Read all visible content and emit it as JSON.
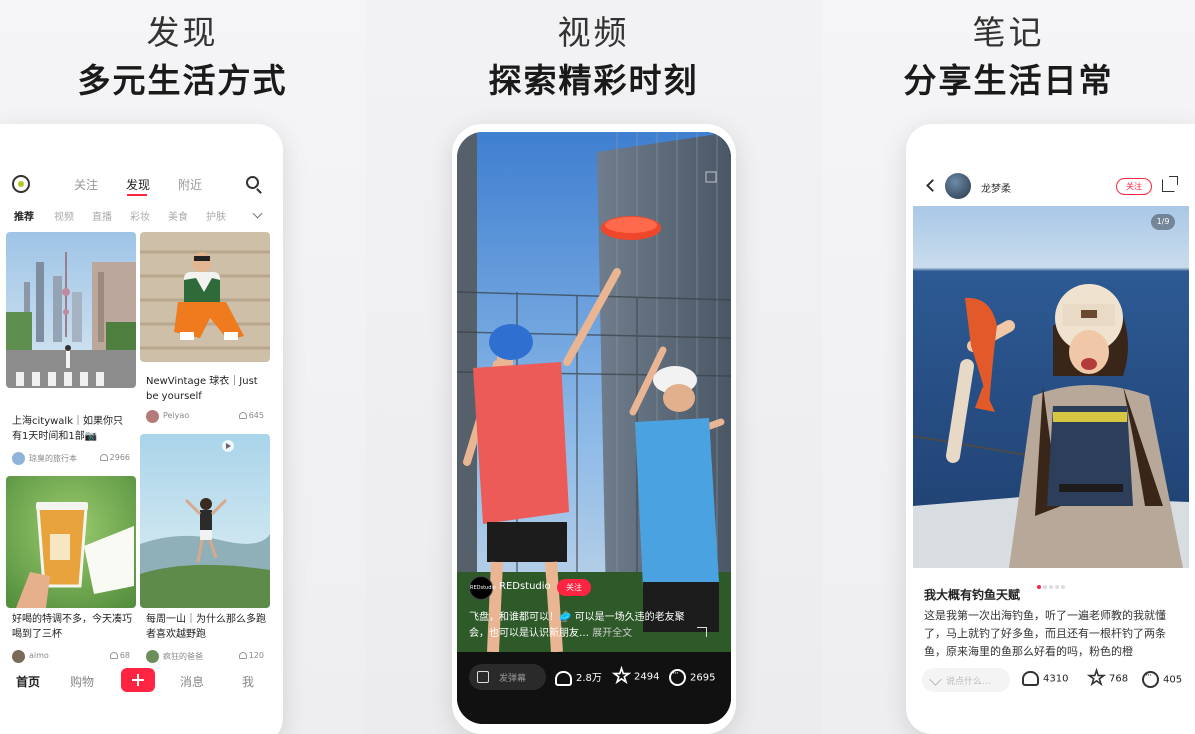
{
  "panels": [
    {
      "title": "发现",
      "subtitle": "多元生活方式"
    },
    {
      "title": "视频",
      "subtitle": "探索精彩时刻"
    },
    {
      "title": "笔记",
      "subtitle": "分享生活日常"
    }
  ],
  "discover": {
    "top_tabs": [
      "关注",
      "发现",
      "附近"
    ],
    "active_tab": "发现",
    "chips": [
      "推荐",
      "视频",
      "直播",
      "彩妆",
      "美食",
      "护肤"
    ],
    "cards": [
      {
        "title": "上海citywalk｜如果你只有1天时间和1部📷",
        "user": "琼臭的旅行本",
        "likes": "2966"
      },
      {
        "title": "NewVintage 球衣｜Just be yourself",
        "user": "Peiyao",
        "likes": "645"
      },
      {
        "title": "好喝的特调不多，今天凑巧喝到了三杯",
        "user": "aimo",
        "likes": "68"
      },
      {
        "title": "每周一山｜为什么那么多跑者喜欢越野跑",
        "user": "疯狂的爸爸",
        "likes": "120"
      }
    ],
    "bottom_nav": [
      "首页",
      "购物",
      "消息",
      "我"
    ]
  },
  "video": {
    "author": "REDstudio",
    "avatar_text": "REDstudio",
    "follow": "关注",
    "caption": "飞盘，和谁都可以！🥏 可以是一场久违的老友聚会，也可以是认识新朋友…",
    "more": "展开全文",
    "danmu": "发弹幕",
    "likes": "2.8万",
    "stars": "2494",
    "comments": "2695"
  },
  "note": {
    "author": "龙梦柔",
    "follow": "关注",
    "pager": "1/9",
    "title": "我大概有钓鱼天赋",
    "body": "这是我第一次出海钓鱼，听了一遍老师教的我就懂了，马上就钓了好多鱼，而且还有一根杆钓了两条鱼，原来海里的鱼那么好看的吗，粉色的橙",
    "comment_placeholder": "说点什么...",
    "likes": "4310",
    "stars": "768",
    "comments": "405"
  },
  "colors": {
    "brand_red": "#ff2442"
  }
}
